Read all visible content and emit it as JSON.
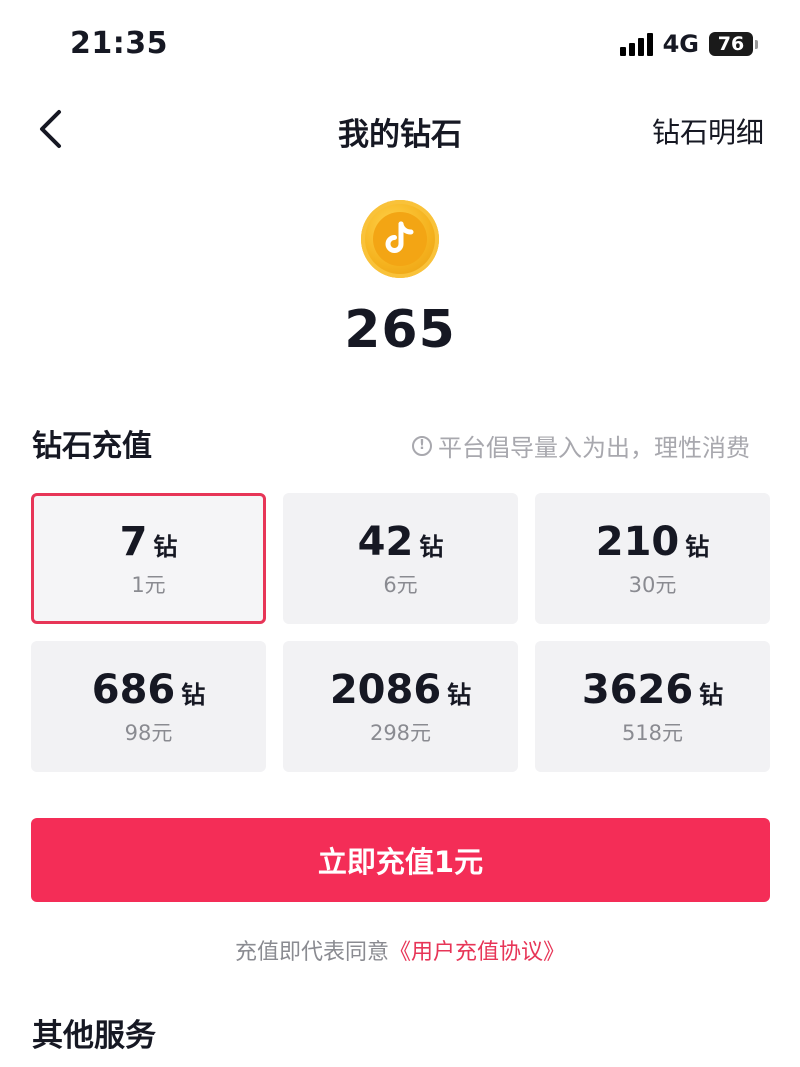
{
  "status_bar": {
    "time": "21:35",
    "network": "4G",
    "battery": "76"
  },
  "nav": {
    "title": "我的钻石",
    "right_label": "钻石明细"
  },
  "balance": {
    "amount": "265"
  },
  "recharge": {
    "title": "钻石充值",
    "notice": "平台倡导量入为出，理性消费",
    "notice_icon": "!",
    "packages": [
      {
        "amount": "7",
        "unit": "钻",
        "price": "1元",
        "selected": true
      },
      {
        "amount": "42",
        "unit": "钻",
        "price": "6元",
        "selected": false
      },
      {
        "amount": "210",
        "unit": "钻",
        "price": "30元",
        "selected": false
      },
      {
        "amount": "686",
        "unit": "钻",
        "price": "98元",
        "selected": false
      },
      {
        "amount": "2086",
        "unit": "钻",
        "price": "298元",
        "selected": false
      },
      {
        "amount": "3626",
        "unit": "钻",
        "price": "518元",
        "selected": false
      }
    ],
    "button_label": "立即充值1元"
  },
  "agreement": {
    "prefix": "充值即代表同意",
    "link": "《用户充值协议》"
  },
  "other_services": {
    "title": "其他服务"
  },
  "colors": {
    "accent": "#f42d57",
    "selected_border": "#e73557",
    "coin": "#f5b21e"
  },
  "icons": {
    "back": "chevron-left-icon",
    "coin": "douyin-coin-icon",
    "notice": "info-icon"
  }
}
